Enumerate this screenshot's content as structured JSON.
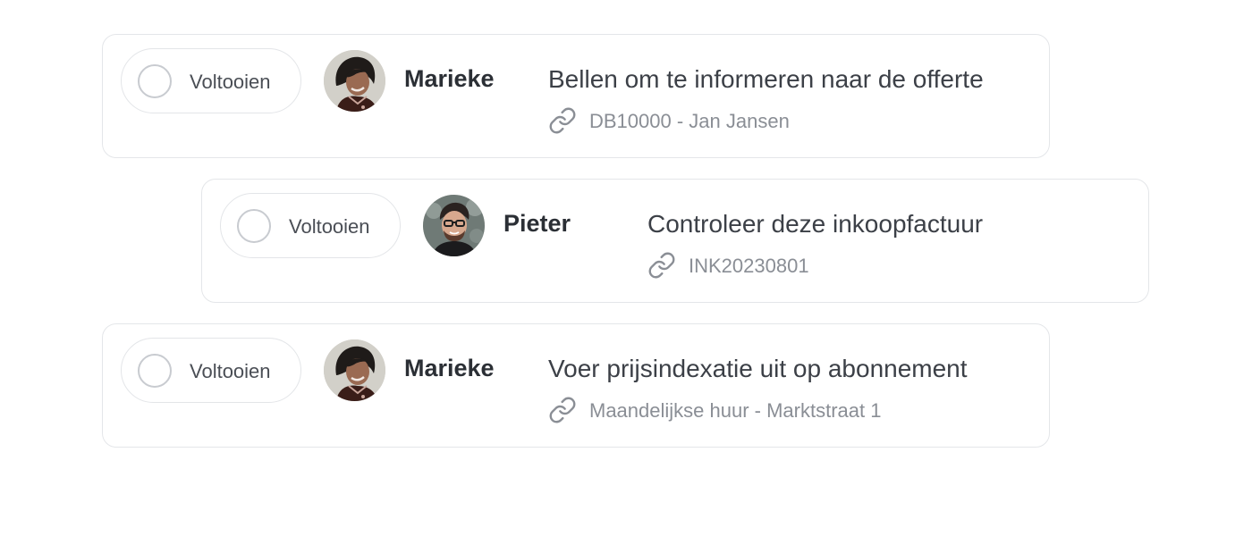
{
  "tasks": [
    {
      "complete_label": "Voltooien",
      "assignee": "Marieke",
      "avatar": "woman-avatar",
      "title": "Bellen om te informeren naar de offerte",
      "link_icon": "link-icon",
      "link_text": "DB10000 - Jan Jansen"
    },
    {
      "complete_label": "Voltooien",
      "assignee": "Pieter",
      "avatar": "man-avatar",
      "title": "Controleer deze inkoopfactuur",
      "link_icon": "link-icon",
      "link_text": "INK20230801"
    },
    {
      "complete_label": "Voltooien",
      "assignee": "Marieke",
      "avatar": "woman-avatar",
      "title": "Voer prijsindexatie uit op abonnement",
      "link_icon": "link-icon",
      "link_text": "Maandelijkse huur - Marktstraat 1"
    }
  ],
  "colors": {
    "card_border": "#e4e6e9",
    "text_primary": "#3c4047",
    "text_secondary": "#8a8e95"
  }
}
